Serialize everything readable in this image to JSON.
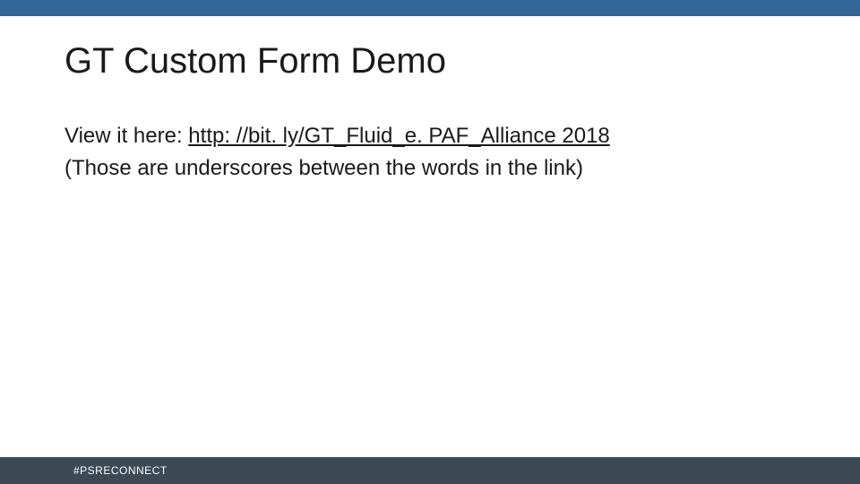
{
  "title": "GT Custom Form Demo",
  "body": {
    "prefix": "View it here: ",
    "link_text": "http: //bit. ly/GT_Fluid_e. PAF_Alliance 2018",
    "link_href": "http://bit.ly/GT_Fluid_ePAF_Alliance2018",
    "note": "(Those are underscores between the words in the link)"
  },
  "footer": {
    "hashtag": "#PSRECONNECT"
  }
}
